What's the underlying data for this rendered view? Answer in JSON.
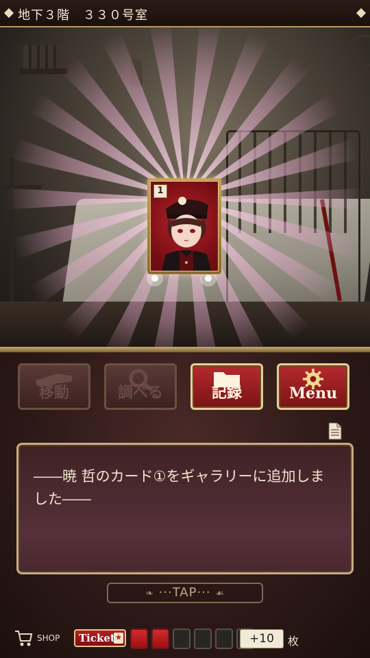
{
  "location": {
    "title": "地下３階　３３０号室"
  },
  "card": {
    "number": "1",
    "character_name": "暁 哲"
  },
  "menu": {
    "move_label": "移動",
    "examine_label": "調べる",
    "record_label": "記録",
    "menu_label": "Menu"
  },
  "message": {
    "text": "――暁 哲のカード①をギャラリーに追加しました――"
  },
  "tap": {
    "label": "···TAP···"
  },
  "footer": {
    "shop_label": "SHOP",
    "ticket_label": "Ticket",
    "ticket_slots_filled": 2,
    "ticket_slots_total": 6,
    "plus_label": "+10",
    "unit_label": "枚"
  },
  "colors": {
    "accent_red": "#b62a2e",
    "gold": "#c6ad7d",
    "panel_dark": "#221412"
  }
}
